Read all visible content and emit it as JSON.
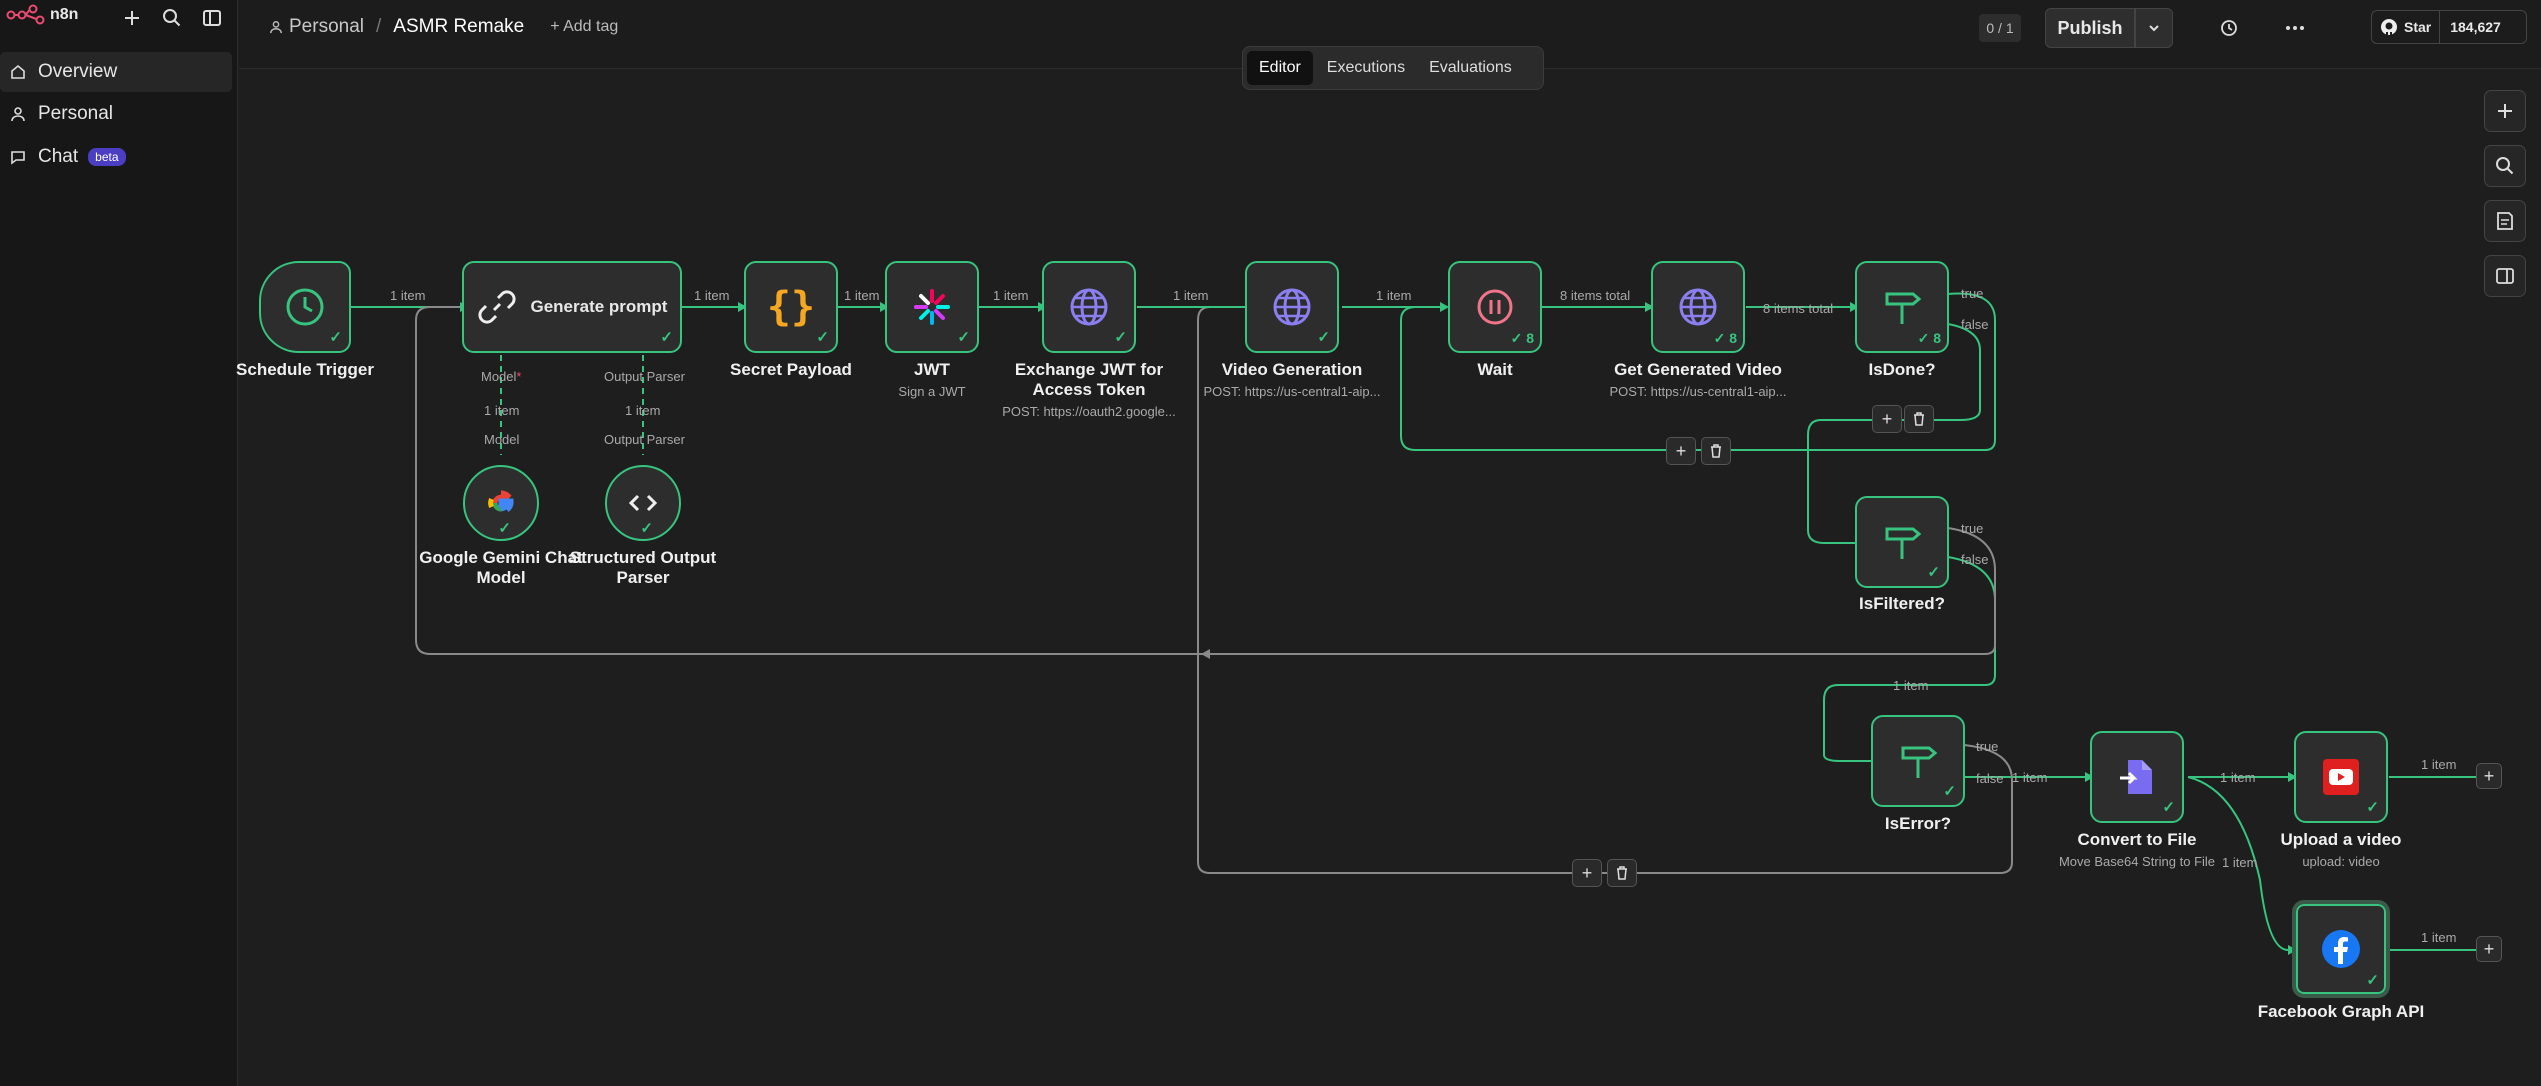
{
  "app": {
    "name": "n8n"
  },
  "sidebar": {
    "items": [
      {
        "label": "Overview"
      },
      {
        "label": "Personal"
      },
      {
        "label": "Chat",
        "badge": "beta"
      }
    ]
  },
  "header": {
    "project": "Personal",
    "separator": "/",
    "workflow_name": "ASMR Remake",
    "add_tag": "+ Add tag",
    "tabs": [
      {
        "label": "Editor",
        "active": true
      },
      {
        "label": "Executions"
      },
      {
        "label": "Evaluations"
      }
    ],
    "counter": "0 / 1",
    "publish_label": "Publish",
    "github_star_label": "Star",
    "github_stars": "184,627"
  },
  "colors": {
    "accent_green": "#37c47f",
    "primary": "#e8e8e8"
  },
  "nodes": [
    {
      "id": "schedule",
      "label": "Schedule Trigger",
      "icon": "clock-icon"
    },
    {
      "id": "generate",
      "label": "Generate prompt",
      "icon": "link-icon"
    },
    {
      "id": "secret",
      "label": "Secret Payload",
      "icon": "braces-icon"
    },
    {
      "id": "jwt",
      "label": "JWT",
      "sub": "Sign a JWT",
      "icon": "jwt-icon"
    },
    {
      "id": "exchange",
      "label": "Exchange JWT for Access Token",
      "sub": "POST: https://oauth2.google...",
      "icon": "globe-icon"
    },
    {
      "id": "videogen",
      "label": "Video Generation",
      "sub": "POST: https://us-central1-aip...",
      "icon": "globe-icon"
    },
    {
      "id": "wait",
      "label": "Wait",
      "icon": "pause-icon",
      "count": "8"
    },
    {
      "id": "getvideo",
      "label": "Get Generated Video",
      "sub": "POST: https://us-central1-aip...",
      "icon": "globe-icon",
      "count": "8"
    },
    {
      "id": "isdone",
      "label": "IsDone?",
      "icon": "signpost-icon",
      "count": "8"
    },
    {
      "id": "isfiltered",
      "label": "IsFiltered?",
      "icon": "signpost-icon"
    },
    {
      "id": "iserror",
      "label": "IsError?",
      "icon": "signpost-icon"
    },
    {
      "id": "convert",
      "label": "Convert to File",
      "sub": "Move Base64 String to File",
      "icon": "file-icon"
    },
    {
      "id": "upload",
      "label": "Upload a video",
      "sub": "upload: video",
      "icon": "youtube-icon"
    },
    {
      "id": "facebook",
      "label": "Facebook Graph API",
      "icon": "facebook-icon"
    },
    {
      "id": "gemini",
      "label": "Google Gemini Chat Model",
      "icon": "google-icon"
    },
    {
      "id": "parser",
      "label": "Structured Output Parser",
      "icon": "code-icon"
    }
  ],
  "labels": {
    "one_item": "1 item",
    "eight_items_total": "8 items total",
    "true": "true",
    "false": "false",
    "model": "Model",
    "output_parser": "Output Parser",
    "required_marker": "*"
  }
}
